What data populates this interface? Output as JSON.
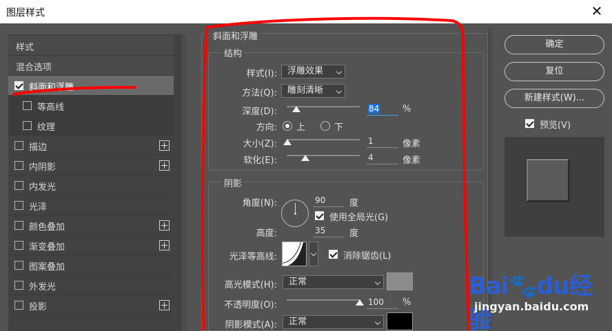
{
  "window": {
    "title": "图层样式",
    "close_glyph": "✕"
  },
  "left_panel": {
    "items": [
      {
        "label": "样式",
        "checkbox": false,
        "checked": false,
        "plus": false
      },
      {
        "label": "混合选项",
        "checkbox": false,
        "checked": false,
        "plus": false
      },
      {
        "label": "斜面和浮雕",
        "checkbox": true,
        "checked": true,
        "plus": false,
        "selected": true
      },
      {
        "label": "等高线",
        "checkbox": true,
        "checked": false,
        "plus": false,
        "indent": true
      },
      {
        "label": "纹理",
        "checkbox": true,
        "checked": false,
        "plus": false,
        "indent": true
      },
      {
        "label": "描边",
        "checkbox": true,
        "checked": false,
        "plus": true
      },
      {
        "label": "内阴影",
        "checkbox": true,
        "checked": false,
        "plus": true
      },
      {
        "label": "内发光",
        "checkbox": true,
        "checked": false,
        "plus": false
      },
      {
        "label": "光泽",
        "checkbox": true,
        "checked": false,
        "plus": false
      },
      {
        "label": "颜色叠加",
        "checkbox": true,
        "checked": false,
        "plus": true
      },
      {
        "label": "渐变叠加",
        "checkbox": true,
        "checked": false,
        "plus": true
      },
      {
        "label": "图案叠加",
        "checkbox": true,
        "checked": false,
        "plus": false
      },
      {
        "label": "外发光",
        "checkbox": true,
        "checked": false,
        "plus": false
      },
      {
        "label": "投影",
        "checkbox": true,
        "checked": false,
        "plus": true
      }
    ]
  },
  "bevel": {
    "section_title": "斜面和浮雕",
    "structure_title": "结构",
    "style_label": "样式(I):",
    "style_value": "浮雕效果",
    "technique_label": "方法(Q):",
    "technique_value": "雕刻清晰",
    "depth_label": "深度(D):",
    "depth_value": "84",
    "depth_unit": "%",
    "depth_fraction": 0.08,
    "direction_label": "方向:",
    "direction_up": "上",
    "direction_down": "下",
    "size_label": "大小(Z):",
    "size_value": "1",
    "size_unit": "像素",
    "size_fraction": 0.01,
    "soften_label": "软化(E):",
    "soften_value": "4",
    "soften_unit": "像素",
    "soften_fraction": 0.25
  },
  "shading": {
    "title": "阴影",
    "angle_label": "角度(N):",
    "angle_value": "90",
    "angle_unit": "度",
    "global_light_label": "使用全局光(G)",
    "altitude_label": "高度:",
    "altitude_value": "35",
    "altitude_unit": "度",
    "gloss_contour_label": "光泽等高线:",
    "antialias_label": "消除锯齿(L)",
    "highlight_mode_label": "高光模式(H):",
    "highlight_mode_value": "正常",
    "highlight_color": "#8c8c8c",
    "opacity_label": "不透明度(O):",
    "opacity_value": "100",
    "opacity_unit": "%",
    "opacity_fraction": 1.0,
    "shadow_mode_label": "阴影模式(A):",
    "shadow_mode_value": "正常",
    "shadow_color": "#000000"
  },
  "buttons": {
    "ok": "确定",
    "reset": "复位",
    "new_style": "新建样式(W)...",
    "preview": "预览(V)"
  },
  "watermark": {
    "logo": "Bai🐾du经验",
    "url": "jingyan.baidu.com"
  },
  "colors": {
    "annotation_red": "#ff0000",
    "panel_bg": "#535353"
  }
}
